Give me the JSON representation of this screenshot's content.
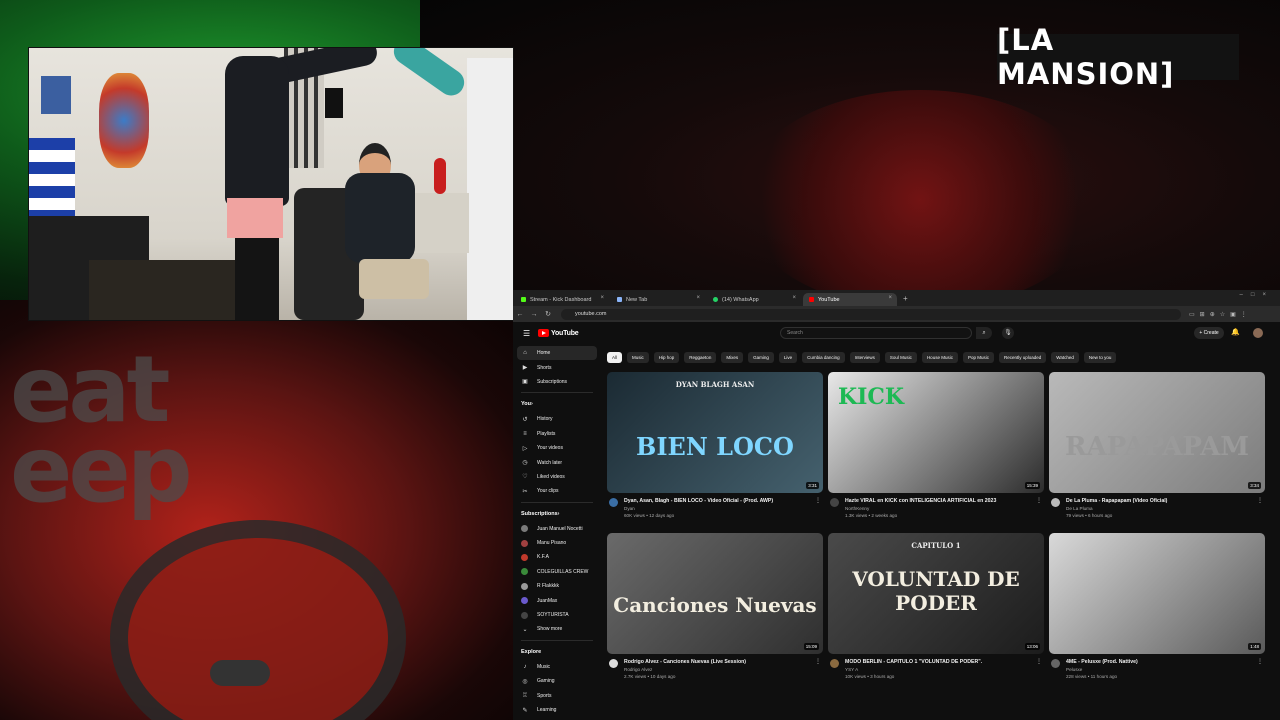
{
  "overlay": {
    "logo_text": "[LA MANSION]",
    "bg_text": "eat\neep"
  },
  "browser": {
    "tabs": [
      {
        "label": "Stream - Kick Dashboard",
        "color": "#53fc18"
      },
      {
        "label": "New Tab",
        "color": "#8ab4f8"
      },
      {
        "label": "(14) WhatsApp",
        "color": "#25d366"
      },
      {
        "label": "YouTube",
        "color": "#ff0000"
      }
    ],
    "url": "youtube.com"
  },
  "youtube": {
    "logo_text": "YouTube",
    "search_placeholder": "Search",
    "create_label": "Create",
    "sidebar": {
      "main": [
        {
          "label": "Home",
          "icon": "home-icon",
          "glyph": "⌂"
        },
        {
          "label": "Shorts",
          "icon": "shorts-icon",
          "glyph": "▶"
        },
        {
          "label": "Subscriptions",
          "icon": "subscriptions-icon",
          "glyph": "▣"
        }
      ],
      "you_heading": "You",
      "you": [
        {
          "label": "History",
          "icon": "history-icon",
          "glyph": "↺"
        },
        {
          "label": "Playlists",
          "icon": "playlists-icon",
          "glyph": "≡"
        },
        {
          "label": "Your videos",
          "icon": "your-videos-icon",
          "glyph": "▷"
        },
        {
          "label": "Watch later",
          "icon": "watch-later-icon",
          "glyph": "◷"
        },
        {
          "label": "Liked videos",
          "icon": "liked-videos-icon",
          "glyph": "♡"
        },
        {
          "label": "Your clips",
          "icon": "clips-icon",
          "glyph": "✂"
        }
      ],
      "subscriptions_heading": "Subscriptions",
      "subscriptions": [
        {
          "label": "Juan Manuel Nocetti",
          "color": "#7a7a7a"
        },
        {
          "label": "Manu Pisano",
          "color": "#a04040"
        },
        {
          "label": "K.F.A",
          "color": "#c0392b"
        },
        {
          "label": "COLEGUILLAS CREW",
          "color": "#3a8a3a"
        },
        {
          "label": "R Flakkkk",
          "color": "#999"
        },
        {
          "label": "JuanMax",
          "color": "#6a5acd"
        },
        {
          "label": "SOYTURISTA",
          "color": "#444"
        },
        {
          "label": "Show more",
          "color": ""
        }
      ],
      "explore_heading": "Explore",
      "explore": [
        {
          "label": "Music",
          "icon": "music-icon",
          "glyph": "♪"
        },
        {
          "label": "Gaming",
          "icon": "gaming-icon",
          "glyph": "◎"
        },
        {
          "label": "Sports",
          "icon": "sports-icon",
          "glyph": "♖"
        },
        {
          "label": "Learning",
          "icon": "learning-icon",
          "glyph": "✎"
        }
      ]
    },
    "chips": [
      "All",
      "Music",
      "Hip hop",
      "Reggaeton",
      "Mixes",
      "Gaming",
      "Live",
      "Cumbia dancing",
      "Interviews",
      "Soul Music",
      "House Music",
      "Pop Music",
      "Recently uploaded",
      "Watched",
      "New to you"
    ],
    "videos": [
      {
        "title": "Dyan, Asan, Blagh - BIEN LOCO - Video Oficial - (Prod. AWP)",
        "channel": "Dyan",
        "stats": "60K views • 12 days ago",
        "duration": "3:31",
        "thumb_text": "BIEN LOCO",
        "thumb_top": "DYAN BLAGH ASAN",
        "colors": [
          "#1b2a33",
          "#45616e"
        ],
        "avatar": "#3a6ea5"
      },
      {
        "title": "Hazte VIRAL en KICK con INTELIGENCIA ARTIFICIAL en 2023",
        "channel": "NorthKenny",
        "stats": "1.3K views • 2 weeks ago",
        "duration": "15:39",
        "thumb_text": "KICK",
        "thumb_top": "",
        "colors": [
          "#e8e8e8",
          "#2c2c2c"
        ],
        "avatar": "#444"
      },
      {
        "title": "De La Pluma - Rapapapam (Video Oficial)",
        "channel": "De La Pluma",
        "stats": "79 views • 6 hours ago",
        "duration": "3:34",
        "thumb_text": "RAPAPAPAM",
        "thumb_top": "",
        "colors": [
          "#b9b9b9",
          "#7c7c7c"
        ],
        "avatar": "#bbb"
      },
      {
        "title": "Rodrigo Alvez - Canciones Nuevas (Live Session)",
        "channel": "Rodrigo Alvez",
        "stats": "2.7K views • 10 days ago",
        "duration": "15:09",
        "thumb_text": "Canciones Nuevas",
        "thumb_top": "",
        "colors": [
          "#6a6a6a",
          "#2f2f2f"
        ],
        "avatar": "#ddd"
      },
      {
        "title": "MODO BERLIN - CAPITULO 1 \"VOLUNTAD DE PODER\".",
        "channel": "YSY A",
        "stats": "10K views • 3 hours ago",
        "duration": "13:06",
        "thumb_text": "VOLUNTAD DE PODER",
        "thumb_top": "CAPITULO 1",
        "colors": [
          "#4a4a4a",
          "#1c1c1c"
        ],
        "avatar": "#8a6a40"
      },
      {
        "title": "4ME - Pelusxe (Prod. Nattive)",
        "channel": "Pelusxe",
        "stats": "228 views • 11 hours ago",
        "duration": "1:48",
        "thumb_text": "",
        "thumb_top": "",
        "colors": [
          "#d9d9d9",
          "#5a5a5a"
        ],
        "avatar": "#666"
      }
    ]
  }
}
